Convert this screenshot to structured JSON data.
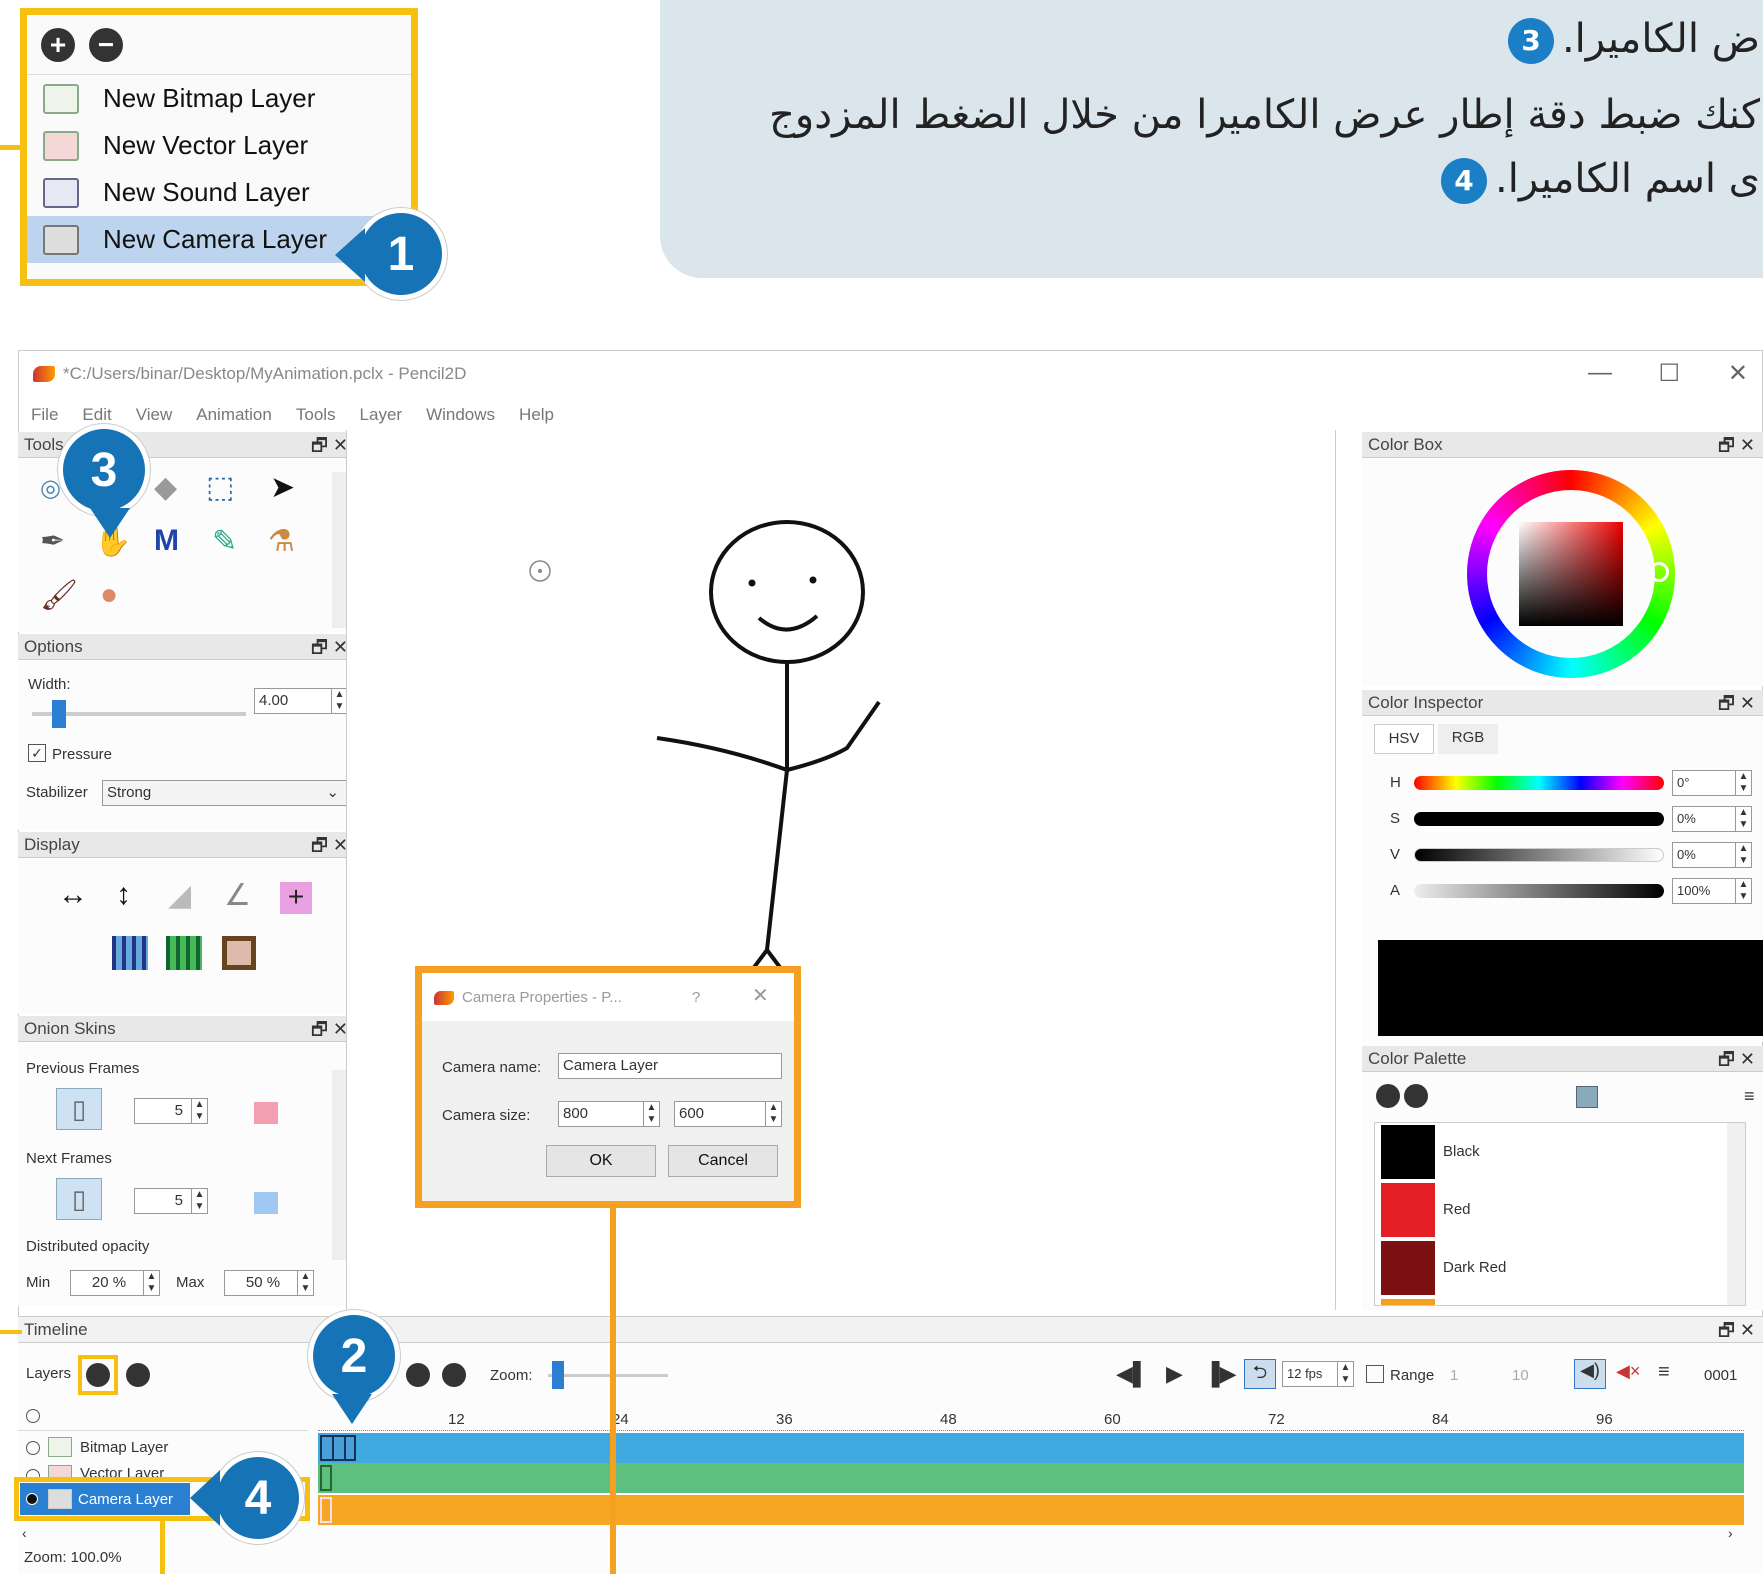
{
  "callout": {
    "line1": "ض الكاميرا.",
    "line1_num": "3",
    "line2": "كنك ضبط دقة إطار عرض الكاميرا من خلال الضغط المزدوج",
    "line3": "ى اسم الكاميرا.",
    "line3_num": "4"
  },
  "layer_menu": {
    "items": [
      {
        "label": "New Bitmap Layer",
        "icon": "bitmap-layer-icon"
      },
      {
        "label": "New Vector Layer",
        "icon": "vector-layer-icon"
      },
      {
        "label": "New Sound Layer",
        "icon": "sound-layer-icon"
      },
      {
        "label": "New Camera Layer",
        "icon": "camera-layer-icon"
      }
    ],
    "add_icon": "plus-circle-icon",
    "remove_icon": "minus-circle-icon",
    "add_glyph": "+",
    "remove_glyph": "−"
  },
  "badges": {
    "b1": "1",
    "b2": "2",
    "b3": "3",
    "b4": "4"
  },
  "window": {
    "title": "*C:/Users/binar/Desktop/MyAnimation.pclx - Pencil2D",
    "minimize": "—",
    "maximize": "☐",
    "close": "✕",
    "menu": [
      "File",
      "Edit",
      "View",
      "Animation",
      "Tools",
      "Layer",
      "Windows",
      "Help"
    ]
  },
  "panels": {
    "tools": "Tools",
    "options": "Options",
    "display": "Display",
    "onion": "Onion Skins",
    "color_box": "Color Box",
    "color_inspector": "Color Inspector",
    "color_palette": "Color Palette",
    "timeline": "Timeline",
    "float_glyph": "🗗",
    "close_glyph": "✕"
  },
  "options": {
    "width_label": "Width:",
    "width_value": "4.00",
    "pressure_label": "Pressure",
    "stabilizer_label": "Stabilizer",
    "stabilizer_value": "Strong"
  },
  "onion": {
    "prev_label": "Previous Frames",
    "prev_value": "5",
    "next_label": "Next Frames",
    "next_value": "5",
    "dist_label": "Distributed opacity",
    "min_label": "Min",
    "min_value": "20 %",
    "max_label": "Max",
    "max_value": "50 %"
  },
  "inspector": {
    "tab_hsv": "HSV",
    "tab_rgb": "RGB",
    "h_label": "H",
    "h_value": "0°",
    "s_label": "S",
    "s_value": "0%",
    "v_label": "V",
    "v_value": "0%",
    "a_label": "A",
    "a_value": "100%"
  },
  "palette": [
    {
      "name": "Black",
      "color": "#000000"
    },
    {
      "name": "Red",
      "color": "#e31e24"
    },
    {
      "name": "Dark Red",
      "color": "#7d1010"
    }
  ],
  "dialog": {
    "title": "Camera Properties - P...",
    "help": "?",
    "close": "✕",
    "name_label": "Camera name:",
    "name_value": "Camera Layer",
    "size_label": "Camera size:",
    "width_value": "800",
    "height_value": "600",
    "ok": "OK",
    "cancel": "Cancel"
  },
  "timeline": {
    "layers_label": "Layers",
    "zoom_label": "Zoom:",
    "fps": "12 fps",
    "range_label": "Range",
    "range_start": "1",
    "range_end": "10",
    "frame_counter": "0001",
    "ruler": [
      "12",
      "24",
      "36",
      "48",
      "60",
      "72",
      "84",
      "96"
    ],
    "layers": [
      {
        "name": "Bitmap Layer",
        "color": "#3fa9e0"
      },
      {
        "name": "Vector Layer",
        "color": "#5fbf7f"
      },
      {
        "name": "Camera Layer",
        "color": "#f5a623"
      }
    ],
    "status_zoom": "Zoom: 100.0%"
  },
  "colors": {
    "accent_yellow": "#f5c010",
    "accent_orange": "#f5a020",
    "badge_blue": "#1573b6"
  }
}
